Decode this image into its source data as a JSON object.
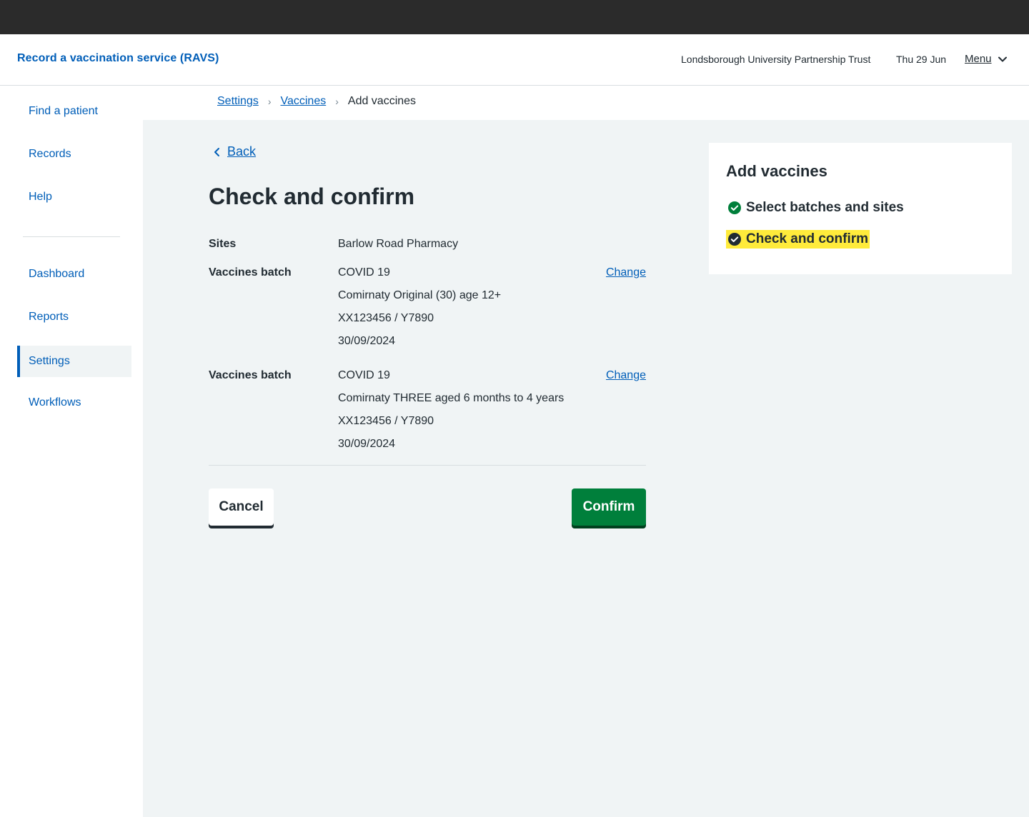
{
  "header": {
    "service_name": "Record a vaccination service (RAVS)",
    "organisation": "Londsborough University Partnership Trust",
    "date": "Thu 29 Jun",
    "menu_label": "Menu"
  },
  "sidebar": {
    "items": [
      {
        "label": "Find a patient"
      },
      {
        "label": "Records"
      },
      {
        "label": "Help"
      },
      {
        "label": "Dashboard"
      },
      {
        "label": "Reports"
      },
      {
        "label": "Settings",
        "active": true
      },
      {
        "label": "Workflows"
      }
    ]
  },
  "breadcrumb": {
    "items": [
      "Settings",
      "Vaccines"
    ],
    "current": "Add vaccines"
  },
  "back_label": "Back",
  "page_title": "Check and confirm",
  "summary": {
    "sites": {
      "key": "Sites",
      "value": "Barlow Road Pharmacy"
    },
    "batches": [
      {
        "key": "Vaccines batch",
        "lines": [
          "COVID 19",
          "Comirnaty Original (30) age 12+",
          "XX123456 / Y7890",
          "30/09/2024"
        ],
        "action": "Change"
      },
      {
        "key": "Vaccines batch",
        "lines": [
          "COVID 19",
          "Comirnaty THREE aged 6 months to 4 years",
          "XX123456 / Y7890",
          "30/09/2024"
        ],
        "action": "Change"
      }
    ]
  },
  "buttons": {
    "cancel": "Cancel",
    "confirm": "Confirm"
  },
  "task_panel": {
    "title": "Add vaccines",
    "steps": [
      {
        "label": "Select batches and sites",
        "status": "complete",
        "icon": "check-circle-green-icon"
      },
      {
        "label": "Check and confirm",
        "status": "current",
        "icon": "check-circle-dark-icon"
      }
    ]
  },
  "colors": {
    "link": "#005eb8",
    "primary_button": "#007f3b",
    "highlight": "#ffeb3b",
    "topbar": "#2b2b2b",
    "background": "#f0f4f5"
  }
}
